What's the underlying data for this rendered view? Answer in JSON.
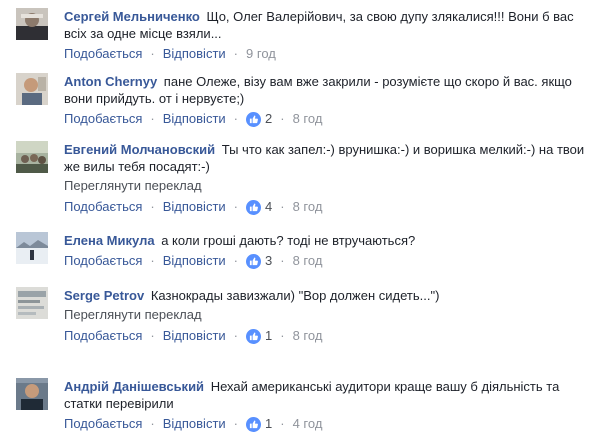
{
  "labels": {
    "like": "Подобається",
    "reply": "Відповісти",
    "translate": "Переглянути переклад",
    "sep": "·"
  },
  "comments": [
    {
      "author": "Сергей Мельниченко",
      "text": "Що, Олег Валерійович, за свою дупу злякалися!!! Вони б вас всіх за одне місце взяли...",
      "reactions": "",
      "time": "9 год"
    },
    {
      "author": "Anton Chernyy",
      "text": "пане Олеже, візу вам вже закрили - розумієте що скоро й вас. якщо вони прийдуть. от і нервуєте;)",
      "reactions": "2",
      "time": "8 год"
    },
    {
      "author": "Евгений Молчановский",
      "text": "Ты что как запел:-) врунишка:-) и воришка мелкий:-) на твои же вилы тебя посадят:-)",
      "reactions": "4",
      "time": "8 год"
    },
    {
      "author": "Елена Микула",
      "text": "а коли гроші дають? тоді не втручаються?",
      "reactions": "3",
      "time": "8 год"
    },
    {
      "author": "Serge Petrov",
      "text": "Казнокрады завизжали) \"Вор должен сидеть...\")",
      "reactions": "1",
      "time": "8 год"
    },
    {
      "author": "Андрій Данішевський",
      "text": "Нехай американські аудитори краще вашу б діяльність та статки перевірили",
      "reactions": "1",
      "time": "4 год"
    }
  ],
  "icons": {
    "like": "thumbs-up-icon"
  },
  "colors": {
    "link": "#385898",
    "meta": "#90949c",
    "like_badge": "#5890ff"
  }
}
